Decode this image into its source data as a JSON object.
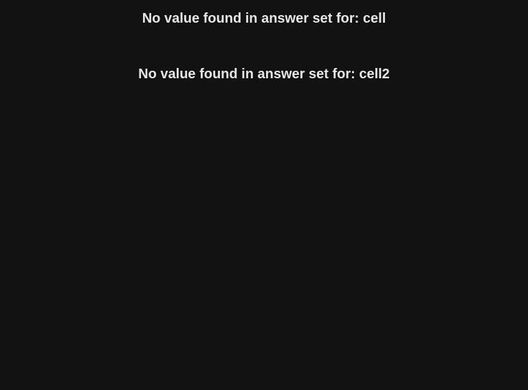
{
  "theme": {
    "background": "#121212",
    "text_color": "#e6e6e6"
  },
  "messages": [
    {
      "text": "No value found in answer set for: cell"
    },
    {
      "text": "No value found in answer set for: cell2"
    }
  ]
}
